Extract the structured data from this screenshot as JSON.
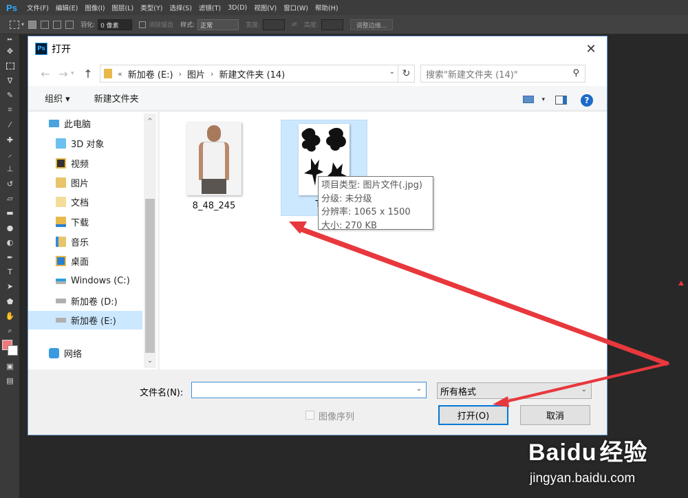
{
  "app": {
    "logo": "Ps",
    "menus": [
      "文件(F)",
      "编辑(E)",
      "图像(I)",
      "图层(L)",
      "类型(Y)",
      "选择(S)",
      "滤镜(T)",
      "3D(D)",
      "视图(V)",
      "窗口(W)",
      "帮助(H)"
    ]
  },
  "options": {
    "feather_label": "羽化:",
    "feather_value": "0 像素",
    "antialias_label": "消除锯齿",
    "style_label": "样式:",
    "style_value": "正常",
    "width_label": "宽度:",
    "height_label": "高度:",
    "refine_label": "调整边缘..."
  },
  "dialog": {
    "title": "打开",
    "breadcrumbs": [
      "«",
      "新加卷 (E:)",
      "›",
      "图片",
      "›",
      "新建文件夹 (14)"
    ],
    "search_placeholder": "搜索\"新建文件夹 (14)\"",
    "organize_label": "组织 ▾",
    "new_folder_label": "新建文件夹",
    "nav_items": [
      "此电脑",
      "3D 对象",
      "视频",
      "图片",
      "文档",
      "下载",
      "音乐",
      "桌面",
      "Windows (C:)",
      "新加卷 (D:)",
      "新加卷 (E:)",
      "网络"
    ],
    "files": [
      {
        "name": "8_48_245"
      },
      {
        "name": "TTU"
      }
    ],
    "tooltip": {
      "type": "项目类型: 图片文件(.jpg)",
      "rating": "分级: 未分级",
      "resolution": "分辨率: 1065 x 1500",
      "size": "大小: 270 KB"
    },
    "filename_label": "文件名(N):",
    "filename_value": "",
    "format_value": "所有格式",
    "sequence_label": "图像序列",
    "open_label": "打开(O)",
    "cancel_label": "取消"
  },
  "watermark": {
    "brand_bai": "Bai",
    "brand_du": "du",
    "brand_jy": "经验",
    "url": "jingyan.baidu.com"
  },
  "colors": {
    "accent": "#0078d7",
    "annotation_arrow": "#e8383d",
    "ps_blue": "#31a8ff"
  }
}
